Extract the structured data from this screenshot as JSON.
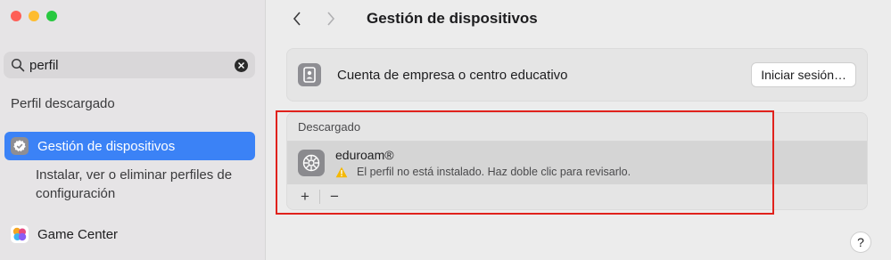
{
  "window": {
    "traffic_colors": {
      "close": "#fe5f57",
      "minimize": "#febc2e",
      "zoom": "#28c840"
    }
  },
  "sidebar": {
    "search": {
      "value": "perfil",
      "icon": "search-icon"
    },
    "section_title": "Perfil descargado",
    "selected_item": {
      "label": "Gestión de dispositivos",
      "icon": "gear-badge-icon"
    },
    "selected_description": "Instalar, ver o eliminar perfiles de configuración",
    "items": [
      {
        "label": "Game Center",
        "icon": "game-center-icon"
      }
    ]
  },
  "main": {
    "title": "Gestión de dispositivos",
    "account_card": {
      "label": "Cuenta de empresa o centro educativo",
      "button": "Iniciar sesión…"
    },
    "downloaded": {
      "header": "Descargado",
      "profiles": [
        {
          "name": "eduroam®",
          "status": "El perfil no está instalado. Haz doble clic para revisarlo."
        }
      ],
      "add_label": "+",
      "remove_label": "−"
    },
    "help_label": "?"
  },
  "colors": {
    "accent": "#3b82f6",
    "highlight_border": "#e0221c",
    "warning": "#f5b800"
  }
}
